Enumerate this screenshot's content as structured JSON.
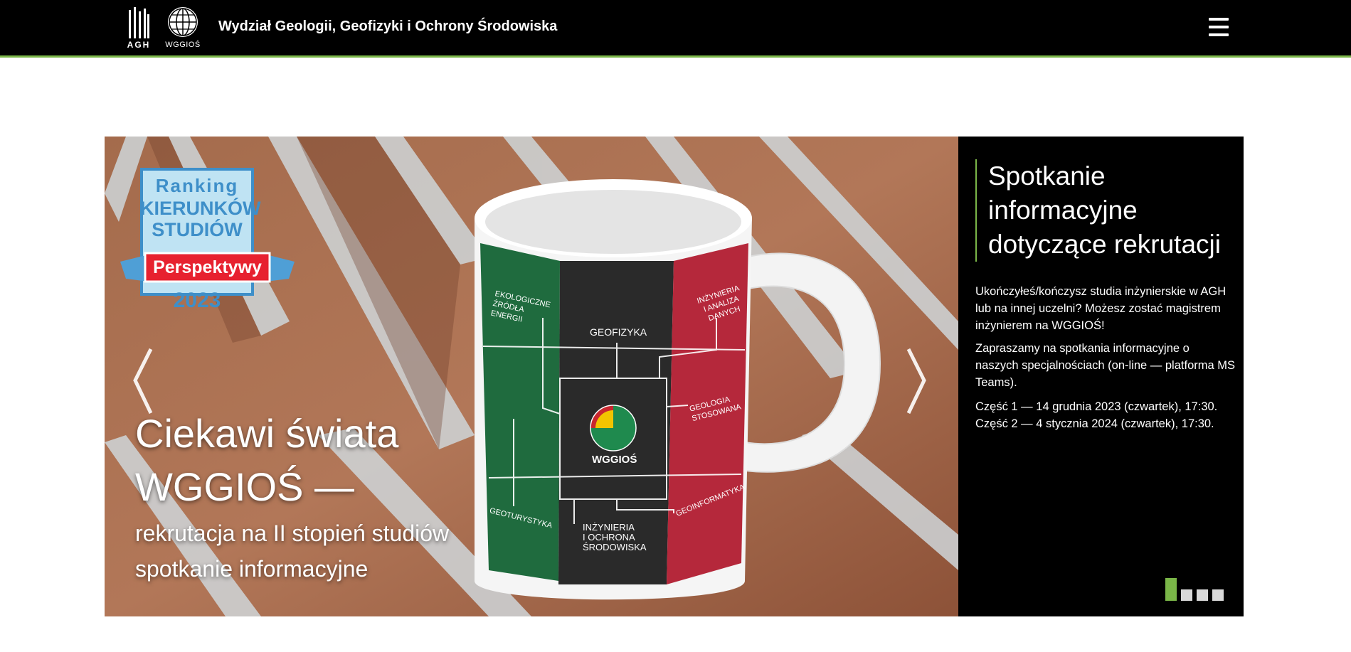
{
  "header": {
    "agh_logo_text": "AGH",
    "wggios_logo_text": "WGGIOŚ",
    "site_title": "Wydział Geologii, Geofizyki i Ochrony Środowiska",
    "menu_icon": "hamburger-menu-icon"
  },
  "slide": {
    "badge": {
      "line1": "Ranking",
      "line2": "KIERUNKÓW",
      "line3": "STUDIÓW",
      "line4": "Perspektywy",
      "line5": "2023"
    },
    "mug_labels": {
      "l1": "EKOLOGICZNE",
      "l2": "ŹRÓDŁA",
      "l3": "ENERGII",
      "l4": "GEOFIZYKA",
      "l5": "INŻYNIERIA",
      "l6": "I ANALIZA",
      "l7": "DANYCH",
      "l8": "GEOLOGIA",
      "l9": "STOSOWANA",
      "l10": "WGGIOŚ",
      "l11": "GEOTURYSTYKA",
      "l12": "INŻYNIERIA",
      "l13": "I OCHRONA",
      "l14": "ŚRODOWISKA",
      "l15": "GEOINFORMATYKA"
    },
    "overlay": {
      "line1": "Ciekawi świata",
      "line2": "WGGIOŚ —",
      "line3": "rekrutacja na II stopień studiów",
      "line4": "spotkanie informacyjne"
    },
    "prev_icon": "chevron-left-icon",
    "next_icon": "chevron-right-icon"
  },
  "caption": {
    "title": "Spotkanie informacyjne dotyczące rekrutacji",
    "p1": "Ukończyłeś/kończysz studia inżynierskie w AGH lub na innej uczelni? Możesz zostać magistrem inżynierem na WGGIOŚ!",
    "p2": "Zapraszamy na spotkania informacyjne o naszych specjalnościach (on-line — platforma MS Teams).",
    "p3a": "Część 1 — 14 grudnia 2023 (czwartek), 17:30.",
    "p3b": "Część 2 — 4 stycznia 2024 (czwartek), 17:30."
  },
  "pagination": {
    "count": 4,
    "active_index": 0
  },
  "colors": {
    "accent": "#7ab648",
    "header_bg": "#000000"
  }
}
